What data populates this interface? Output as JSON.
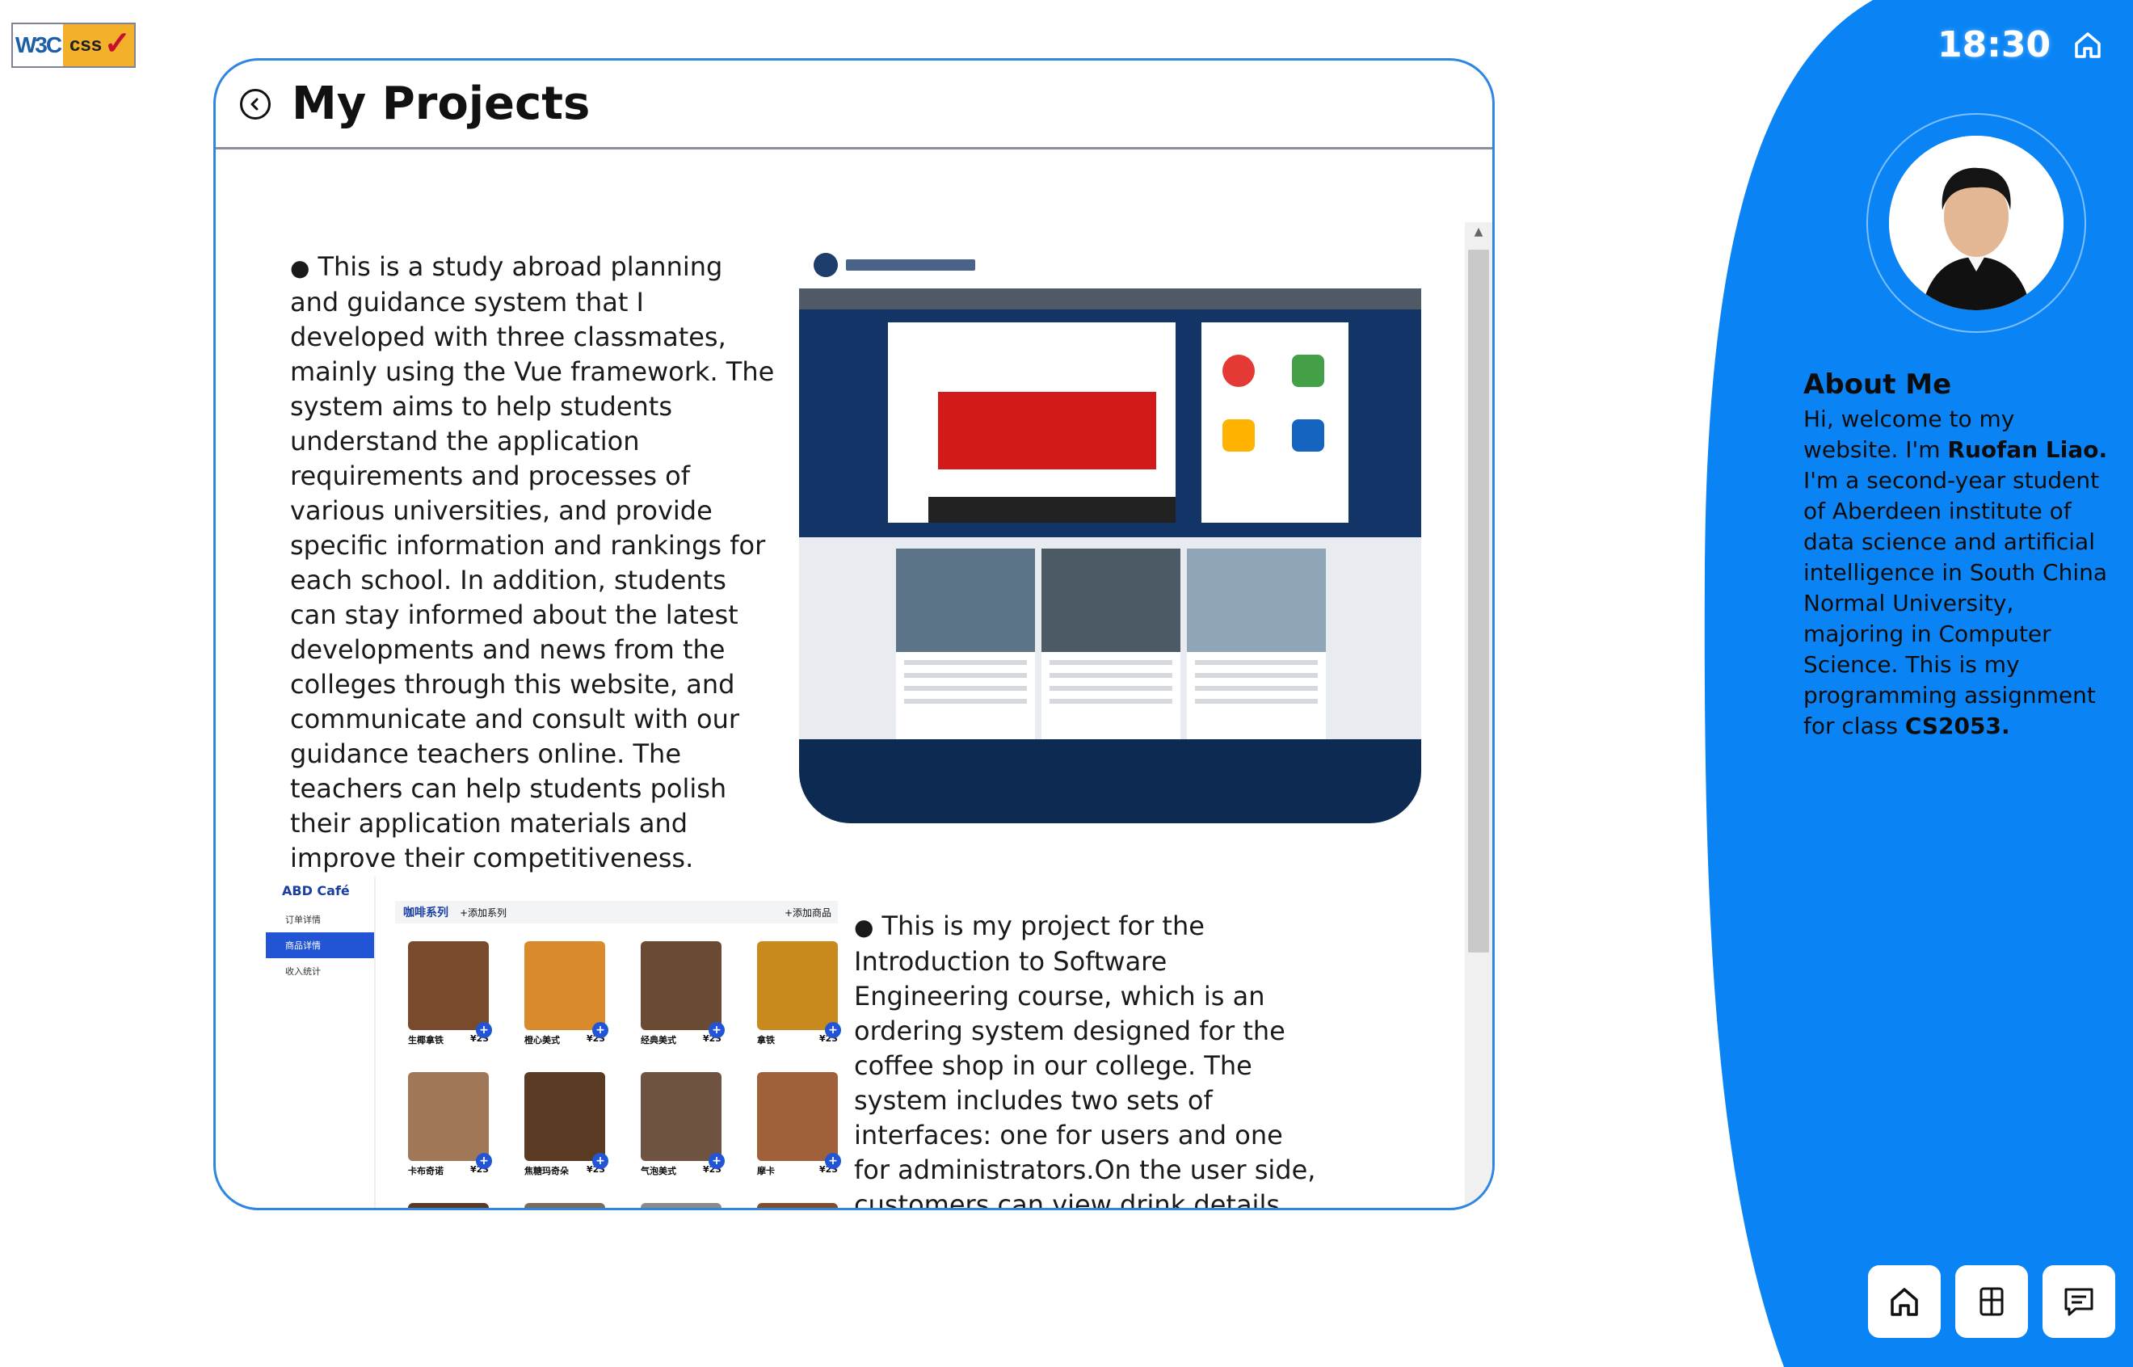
{
  "badge": {
    "w3c": "W3C",
    "css": "css"
  },
  "header": {
    "title": "My Projects"
  },
  "projects": [
    {
      "description": "This is a study abroad planning and guidance system that I developed with three classmates, mainly using the Vue framework. The system aims to help students understand the application requirements and processes of various universities, and provide specific information and rankings for each school. In addition, students can stay informed about the latest developments and news from the colleges through this website, and communicate and consult with our guidance teachers online. The teachers can help students polish their application materials and improve their competitiveness."
    },
    {
      "description": "This is my project for the Introduction to Software Engineering course, which is an ordering system designed for the coffee shop in our college. The system includes two sets of interfaces: one for users and one for administrators.On the user side, customers can view drink details, choose options such as sugar level and temperature, add drinks to their",
      "screenshot": {
        "brand": "ABD Café",
        "menu": [
          "订单详情",
          "商品详情",
          "收入统计"
        ],
        "active_menu": 1,
        "tab": "咖啡系列",
        "add_series": "+添加系列",
        "add_product": "+添加商品",
        "items": [
          {
            "name": "生椰拿铁",
            "price": "¥23"
          },
          {
            "name": "橙心美式",
            "price": "¥23"
          },
          {
            "name": "经典美式",
            "price": "¥23"
          },
          {
            "name": "拿铁",
            "price": "¥23"
          },
          {
            "name": "卡布奇诺",
            "price": "¥23"
          },
          {
            "name": "焦糖玛奇朵",
            "price": "¥23"
          },
          {
            "name": "气泡美式",
            "price": "¥23"
          },
          {
            "name": "摩卡",
            "price": "¥23"
          },
          {
            "name": "",
            "price": ""
          },
          {
            "name": "",
            "price": ""
          },
          {
            "name": "",
            "price": ""
          },
          {
            "name": "",
            "price": ""
          }
        ]
      }
    }
  ],
  "sidebar": {
    "time": "18:30",
    "about_title": "About Me",
    "about_pre": "Hi, welcome to my website. I'm ",
    "about_name": "Ruofan Liao.",
    "about_mid": " I'm a second-year student of Aberdeen institute of data science and artificial intelligence in South China Normal University, majoring in Computer Science. This is my programming assignment for class ",
    "about_class": "CS2053.",
    "dock": [
      "home-icon",
      "grid-icon",
      "message-icon"
    ]
  },
  "colors": {
    "accent": "#0a84f5",
    "card_border": "#2f86e0",
    "dock_bg": "#ffffff"
  }
}
